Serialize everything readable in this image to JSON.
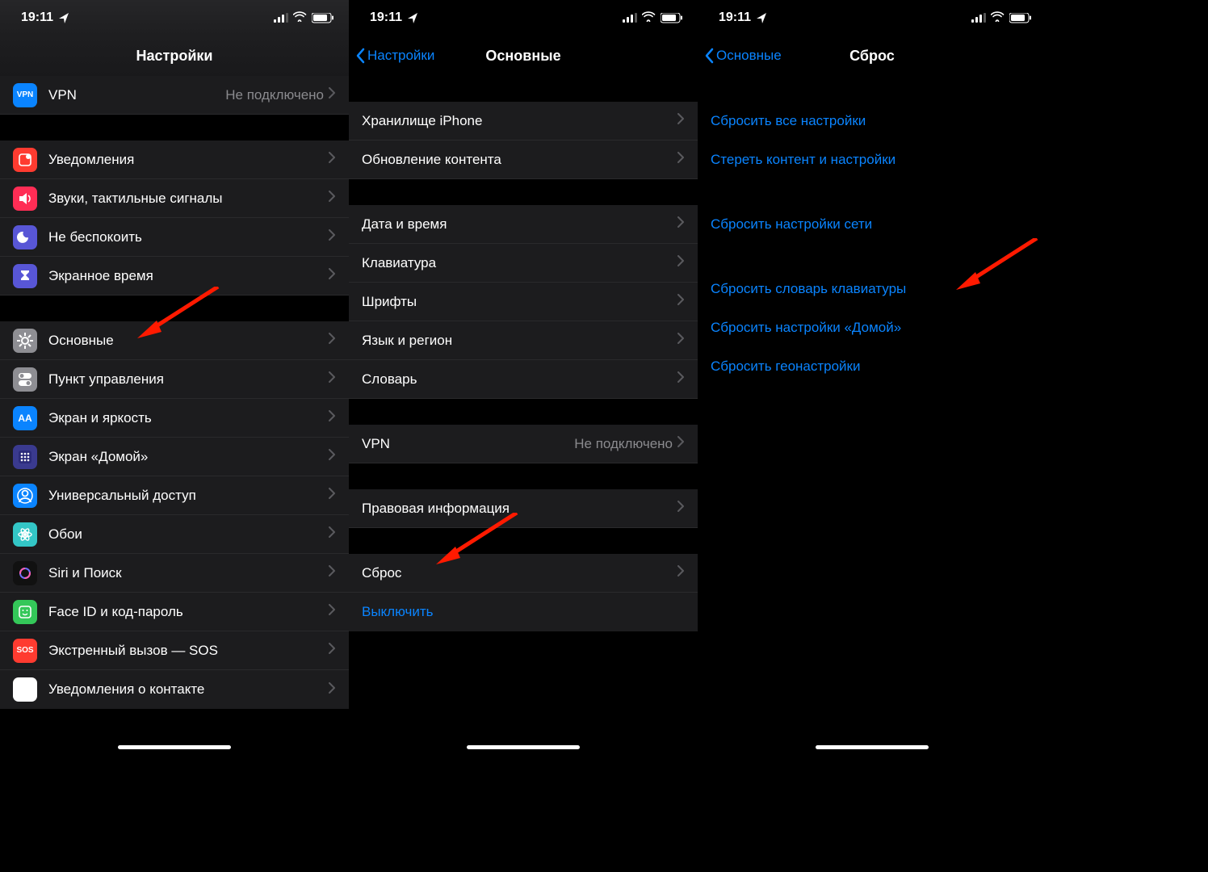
{
  "status": {
    "time": "19:11"
  },
  "titles": {
    "settings": "Настройки",
    "general": "Основные",
    "reset": "Сброс"
  },
  "back": {
    "to_settings": "Настройки",
    "to_general": "Основные"
  },
  "screen1": {
    "vpn": {
      "label": "VPN",
      "detail": "Не подключено"
    },
    "notifications": "Уведомления",
    "sounds": "Звуки, тактильные сигналы",
    "dnd": "Не беспокоить",
    "screentime": "Экранное время",
    "general": "Основные",
    "control_center": "Пункт управления",
    "display": "Экран и яркость",
    "home_screen": "Экран «Домой»",
    "accessibility": "Универсальный доступ",
    "wallpaper": "Обои",
    "siri": "Siri и Поиск",
    "faceid": "Face ID и код-пароль",
    "sos": "Экстренный вызов — SOS",
    "exposure": "Уведомления о контакте"
  },
  "screen2": {
    "storage": "Хранилище iPhone",
    "background_refresh": "Обновление контента",
    "datetime": "Дата и время",
    "keyboard": "Клавиатура",
    "fonts": "Шрифты",
    "language": "Язык и регион",
    "dictionary": "Словарь",
    "vpn": {
      "label": "VPN",
      "detail": "Не подключено"
    },
    "legal": "Правовая информация",
    "reset": "Сброс",
    "shutdown": "Выключить"
  },
  "screen3": {
    "reset_all": "Сбросить все настройки",
    "erase_all": "Стереть контент и настройки",
    "reset_network": "Сбросить настройки сети",
    "reset_keyboard": "Сбросить словарь клавиатуры",
    "reset_home": "Сбросить настройки «Домой»",
    "reset_location": "Сбросить геонастройки"
  },
  "colors": {
    "link": "#0a84ff"
  },
  "icons": {
    "vpn": {
      "bg": "#0a84ff",
      "text": "VPN",
      "fs": "10px"
    },
    "notifications": {
      "bg": "#ff3b30"
    },
    "sounds": {
      "bg": "#ff2d55"
    },
    "dnd": {
      "bg": "#5856d6"
    },
    "screentime": {
      "bg": "#5856d6"
    },
    "general": {
      "bg": "#8e8e93"
    },
    "control_center": {
      "bg": "#8e8e93"
    },
    "display": {
      "bg": "#0a84ff",
      "text": "AA",
      "fs": "12px"
    },
    "home_screen": {
      "bg": "#3a3a8f"
    },
    "accessibility": {
      "bg": "#0a84ff"
    },
    "wallpaper": {
      "bg": "#33c6c6"
    },
    "siri": {
      "bg": "#222"
    },
    "faceid": {
      "bg": "#34c759"
    },
    "sos": {
      "bg": "#ff3b30",
      "text": "SOS",
      "fs": "10px"
    },
    "exposure": {
      "bg": "#ff3b30"
    }
  }
}
